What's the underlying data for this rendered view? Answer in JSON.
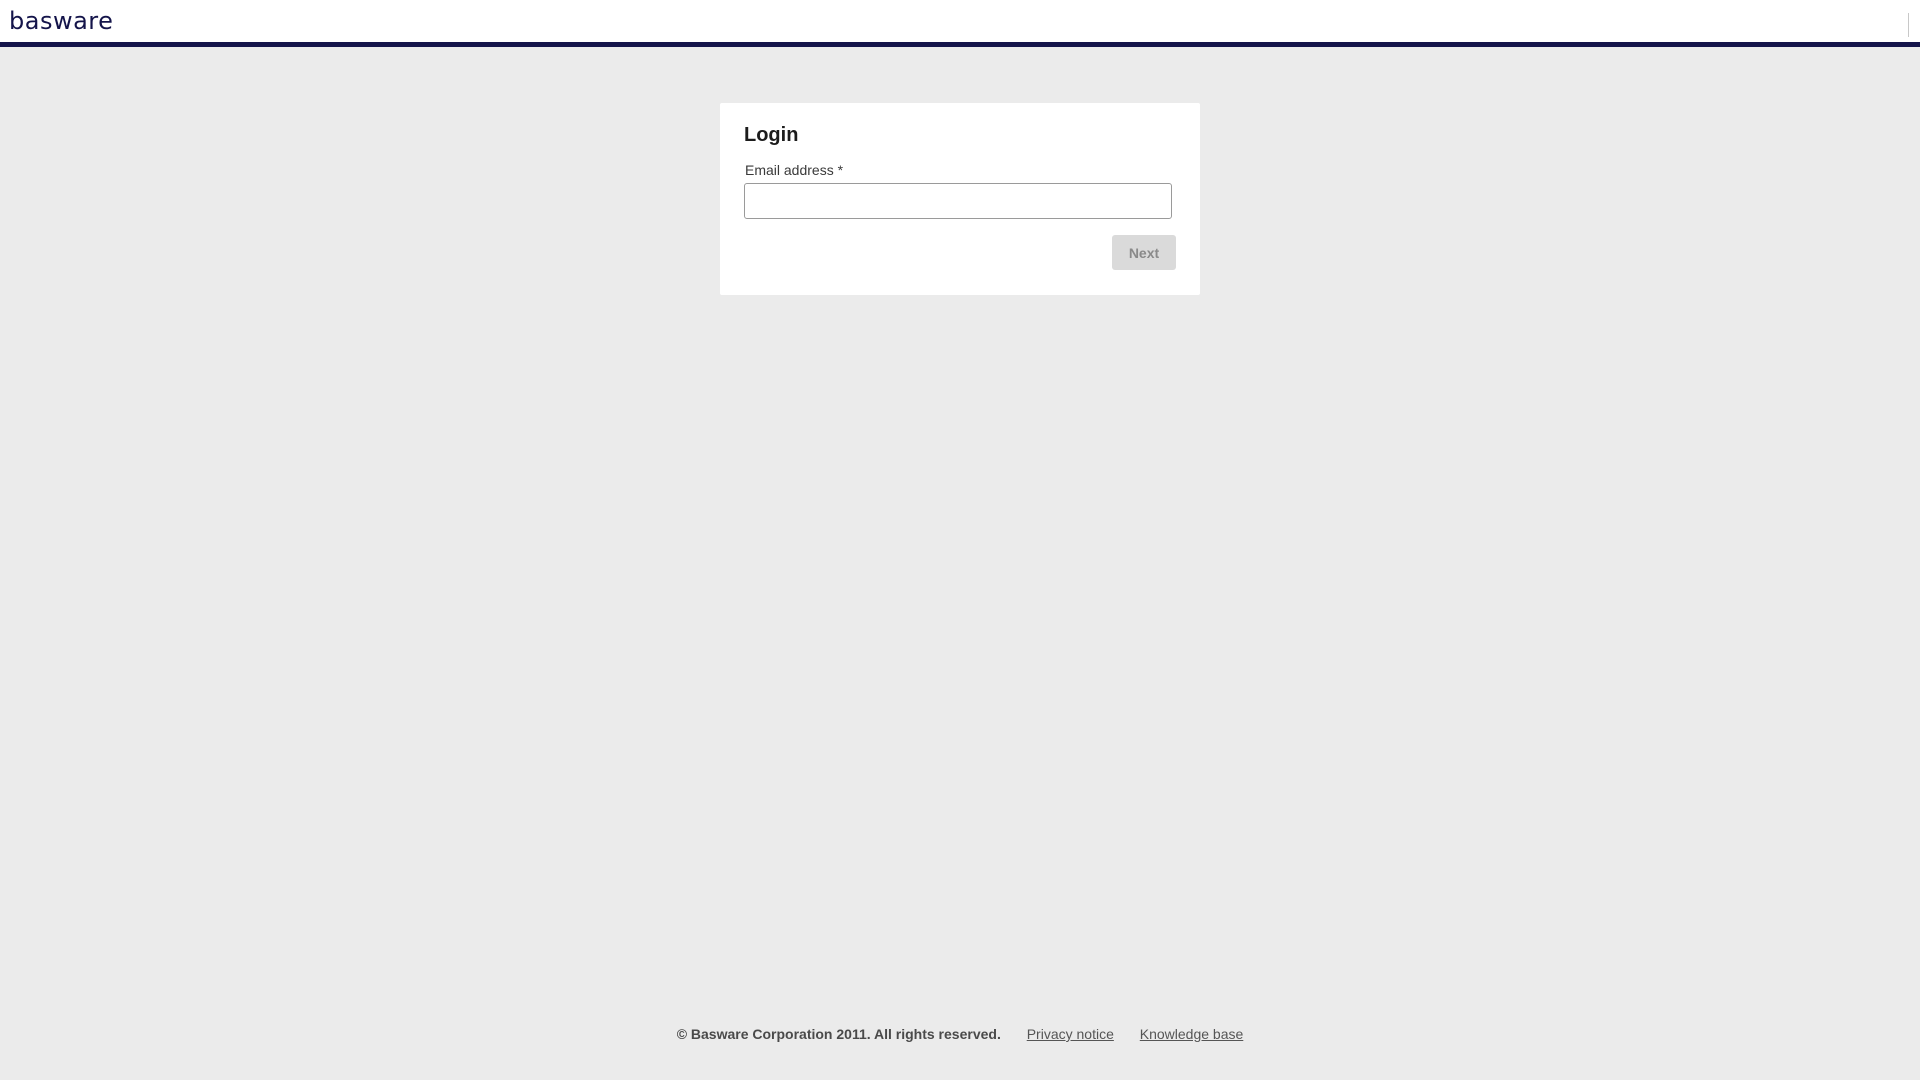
{
  "header": {
    "logo_text": "basware",
    "brand_color": "#14144a"
  },
  "login": {
    "title": "Login",
    "email_label": "Email address *",
    "email_value": "",
    "email_placeholder": "",
    "next_label": "Next",
    "next_enabled": false
  },
  "footer": {
    "copyright": "© Basware Corporation 2011. All rights reserved.",
    "links": [
      {
        "label": "Privacy notice"
      },
      {
        "label": "Knowledge base"
      }
    ]
  },
  "colors": {
    "background": "#ebebeb",
    "card": "#ffffff",
    "button_disabled": "#dadada"
  }
}
